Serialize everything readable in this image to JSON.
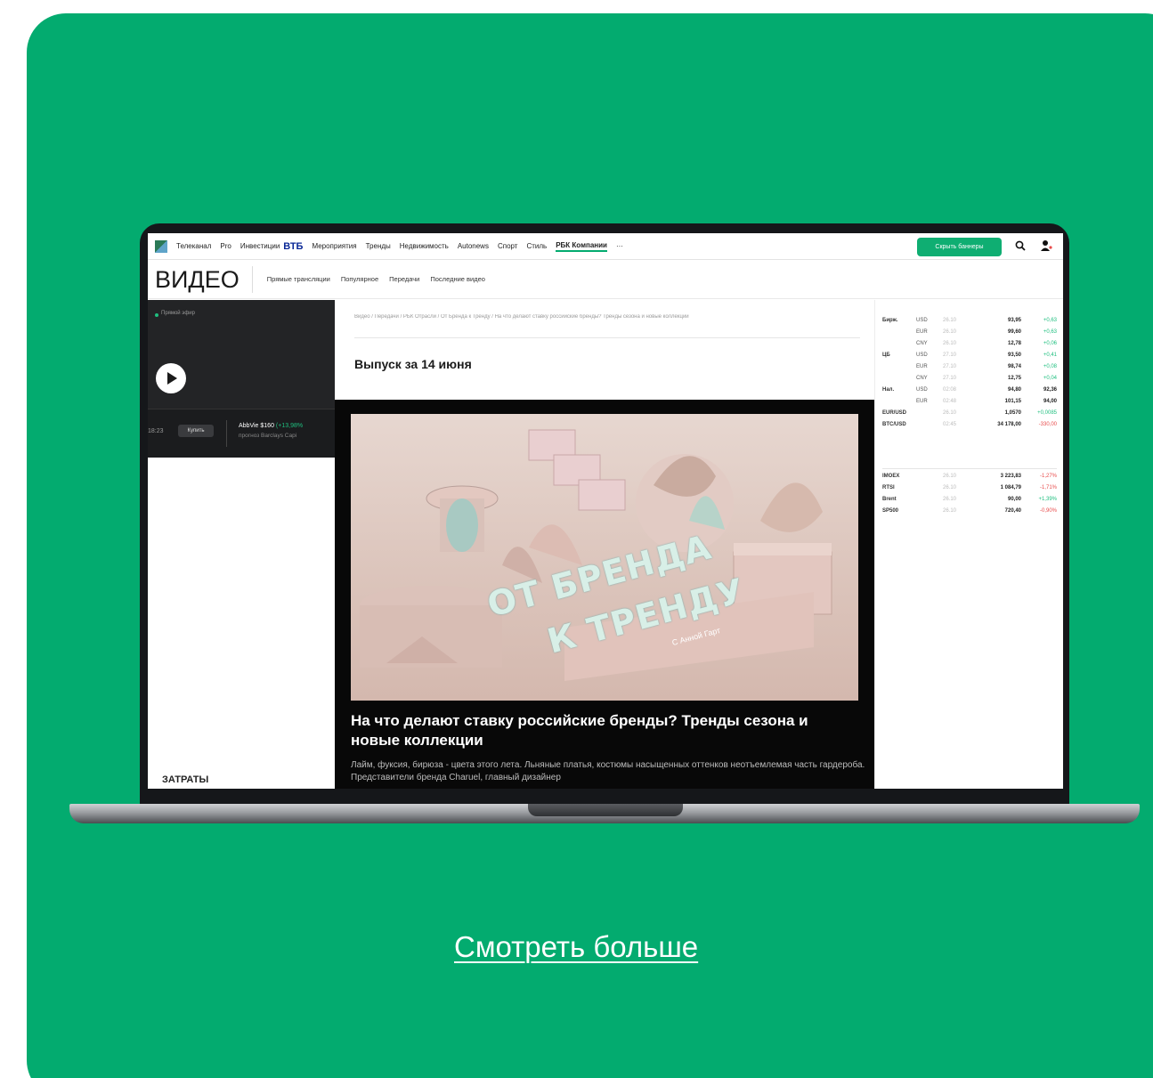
{
  "topnav": {
    "items": [
      "Телеканал",
      "Pro",
      "Инвестиции",
      "ВТБ",
      "Мероприятия",
      "Тренды",
      "Недвижимость",
      "Autonews",
      "Спорт",
      "Стиль",
      "РБК Компании",
      "···"
    ],
    "hide_banners": "Скрыть баннеры",
    "search_icon": "search-icon",
    "user_icon": "user-icon"
  },
  "subnav": {
    "title": "ВИДЕО",
    "items": [
      "Прямые трансляции",
      "Популярное",
      "Передачи",
      "Последние видео"
    ]
  },
  "live": {
    "label": "Прямой эфир",
    "time": "18:23",
    "buy": "Купить",
    "ticker_name": "AbbVie $160",
    "ticker_gain": "(+13,98%",
    "ticker_sub": "прогноз Barclays Capi"
  },
  "left_bottom": "ЗАТРАТЫ",
  "main": {
    "breadcrumb": "Видео / Передачи / РБК Отрасли / От Бренда к Тренду / На что делают ставку российские бренды? Тренды сезона и новые коллекции",
    "issue_title": "Выпуск за 14 июня",
    "thumb_line1": "ОТ БРЕНДА",
    "thumb_line2": "К ТРЕНДУ",
    "thumb_host": "С Анной Гарт",
    "headline": "На что делают ставку российские бренды? Тренды сезона и новые коллекции",
    "description": "Лайм, фуксия, бирюза - цвета этого лета. Льняные платья, костюмы насыщенных оттенков неотъемлемая часть гардероба. Представители бренда Charuel, главный дизайнер"
  },
  "quotes": {
    "rows": [
      {
        "label": "Бирж.",
        "cur": "USD",
        "date": "26.10",
        "value": "93,95",
        "change": "+0,63",
        "dir": "up"
      },
      {
        "label": "",
        "cur": "EUR",
        "date": "26.10",
        "value": "99,60",
        "change": "+0,63",
        "dir": "up"
      },
      {
        "label": "",
        "cur": "CNY",
        "date": "26.10",
        "value": "12,78",
        "change": "+0,06",
        "dir": "up"
      },
      {
        "label": "ЦБ",
        "cur": "USD",
        "date": "27.10",
        "value": "93,50",
        "change": "+0,41",
        "dir": "up"
      },
      {
        "label": "",
        "cur": "EUR",
        "date": "27.10",
        "value": "98,74",
        "change": "+0,08",
        "dir": "up"
      },
      {
        "label": "",
        "cur": "CNY",
        "date": "27.10",
        "value": "12,75",
        "change": "+0,04",
        "dir": "up"
      },
      {
        "label": "Нал.",
        "cur": "USD",
        "date": "02:08",
        "value": "94,80",
        "change": "92,36",
        "dir": "neutral"
      },
      {
        "label": "",
        "cur": "EUR",
        "date": "02:48",
        "value": "101,15",
        "change": "94,00",
        "dir": "neutral"
      },
      {
        "label": "EUR/USD",
        "cur": "",
        "date": "26.10",
        "value": "1,0570",
        "change": "+0,0085",
        "dir": "up"
      },
      {
        "label": "BTC/USD",
        "cur": "",
        "date": "02:45",
        "value": "34 178,00",
        "change": "-330,00",
        "dir": "down"
      },
      {
        "label": "IMOEX",
        "cur": "",
        "date": "26.10",
        "value": "3 223,83",
        "change": "-1,27%",
        "dir": "down"
      },
      {
        "label": "RTSI",
        "cur": "",
        "date": "26.10",
        "value": "1 084,79",
        "change": "-1,71%",
        "dir": "down"
      },
      {
        "label": "Brent",
        "cur": "",
        "date": "26.10",
        "value": "90,00",
        "change": "+1,39%",
        "dir": "up"
      },
      {
        "label": "SP500",
        "cur": "",
        "date": "26.10",
        "value": "720,40",
        "change": "-0,90%",
        "dir": "down"
      }
    ]
  },
  "see_more": "Смотреть больше",
  "colors": {
    "background": "#03ab6f",
    "accent": "#0fae72",
    "up": "#1fbf7f",
    "down": "#e84c4c"
  }
}
